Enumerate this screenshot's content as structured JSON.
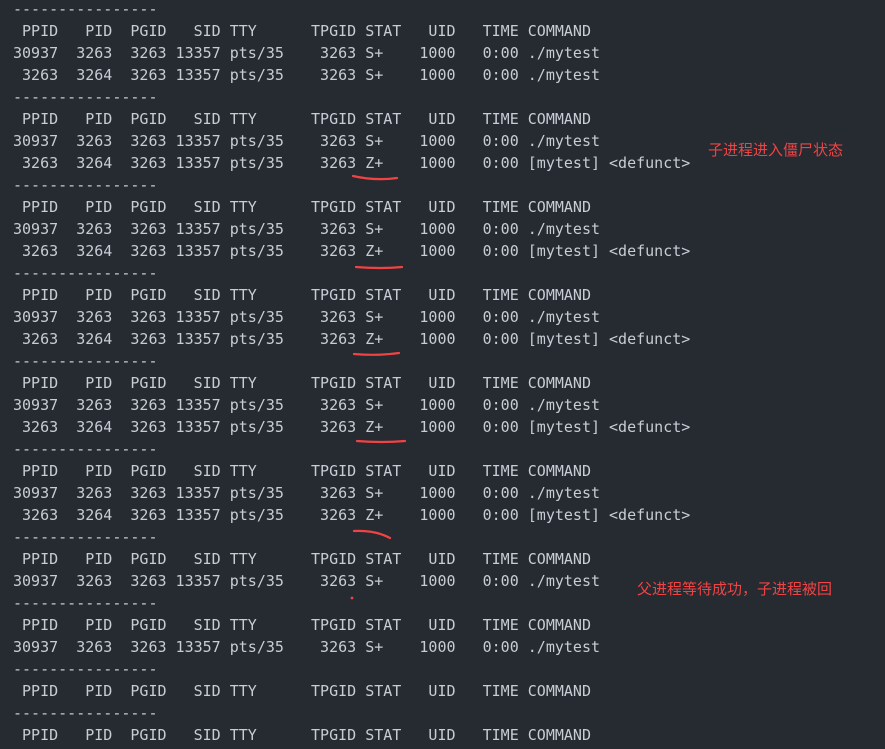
{
  "terminal": {
    "lines": [
      "----------------",
      " PPID   PID  PGID   SID TTY      TPGID STAT   UID   TIME COMMAND",
      "30937  3263  3263 13357 pts/35    3263 S+    1000   0:00 ./mytest",
      " 3263  3264  3263 13357 pts/35    3263 S+    1000   0:00 ./mytest",
      "----------------",
      " PPID   PID  PGID   SID TTY      TPGID STAT   UID   TIME COMMAND",
      "30937  3263  3263 13357 pts/35    3263 S+    1000   0:00 ./mytest",
      " 3263  3264  3263 13357 pts/35    3263 Z+    1000   0:00 [mytest] <defunct>",
      "----------------",
      " PPID   PID  PGID   SID TTY      TPGID STAT   UID   TIME COMMAND",
      "30937  3263  3263 13357 pts/35    3263 S+    1000   0:00 ./mytest",
      " 3263  3264  3263 13357 pts/35    3263 Z+    1000   0:00 [mytest] <defunct>",
      "----------------",
      " PPID   PID  PGID   SID TTY      TPGID STAT   UID   TIME COMMAND",
      "30937  3263  3263 13357 pts/35    3263 S+    1000   0:00 ./mytest",
      " 3263  3264  3263 13357 pts/35    3263 Z+    1000   0:00 [mytest] <defunct>",
      "----------------",
      " PPID   PID  PGID   SID TTY      TPGID STAT   UID   TIME COMMAND",
      "30937  3263  3263 13357 pts/35    3263 S+    1000   0:00 ./mytest",
      " 3263  3264  3263 13357 pts/35    3263 Z+    1000   0:00 [mytest] <defunct>",
      "----------------",
      " PPID   PID  PGID   SID TTY      TPGID STAT   UID   TIME COMMAND",
      "30937  3263  3263 13357 pts/35    3263 S+    1000   0:00 ./mytest",
      " 3263  3264  3263 13357 pts/35    3263 Z+    1000   0:00 [mytest] <defunct>",
      "----------------",
      " PPID   PID  PGID   SID TTY      TPGID STAT   UID   TIME COMMAND",
      "30937  3263  3263 13357 pts/35    3263 S+    1000   0:00 ./mytest",
      "----------------",
      " PPID   PID  PGID   SID TTY      TPGID STAT   UID   TIME COMMAND",
      "30937  3263  3263 13357 pts/35    3263 S+    1000   0:00 ./mytest",
      "----------------",
      " PPID   PID  PGID   SID TTY      TPGID STAT   UID   TIME COMMAND",
      "----------------",
      " PPID   PID  PGID   SID TTY      TPGID STAT   UID   TIME COMMAND"
    ]
  },
  "annotations": {
    "zombie_note": "子进程进入僵尸状态",
    "reaped_note": "父进程等待成功，子进程被回"
  },
  "colors": {
    "background": "#262a31",
    "text": "#c8ccd4",
    "annotation": "#f04444"
  }
}
